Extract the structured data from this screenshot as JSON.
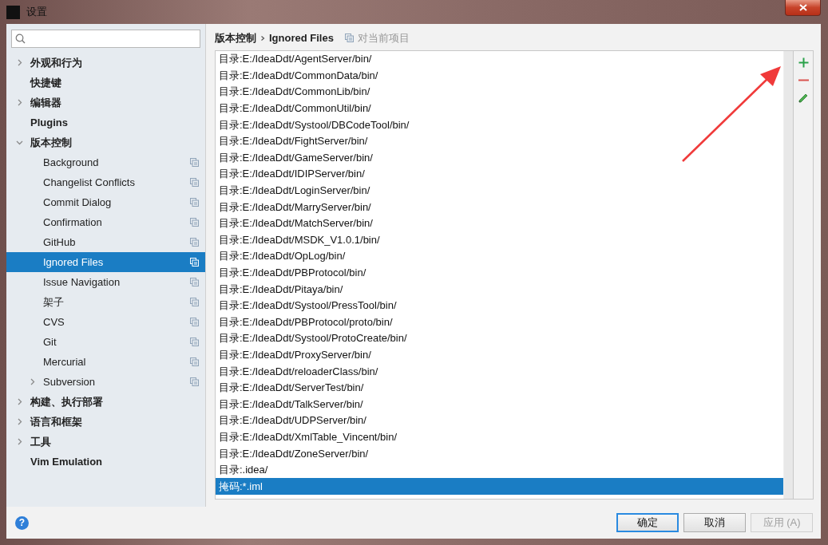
{
  "window": {
    "title": "设置"
  },
  "sidebar": {
    "items": [
      {
        "label": "外观和行为",
        "expanded": false,
        "selected": false
      },
      {
        "label": "快捷键",
        "selected": false
      },
      {
        "label": "编辑器",
        "expanded": false,
        "selected": false
      },
      {
        "label": "Plugins",
        "selected": false
      },
      {
        "label": "版本控制",
        "expanded": true,
        "selected": false,
        "children": [
          {
            "label": "Background",
            "selected": false,
            "project_scope": true
          },
          {
            "label": "Changelist Conflicts",
            "selected": false,
            "project_scope": true
          },
          {
            "label": "Commit Dialog",
            "selected": false,
            "project_scope": true
          },
          {
            "label": "Confirmation",
            "selected": false,
            "project_scope": true
          },
          {
            "label": "GitHub",
            "selected": false,
            "project_scope": true
          },
          {
            "label": "Ignored Files",
            "selected": true,
            "project_scope": true
          },
          {
            "label": "Issue Navigation",
            "selected": false,
            "project_scope": true
          },
          {
            "label": "架子",
            "selected": false,
            "project_scope": true
          },
          {
            "label": "CVS",
            "selected": false,
            "project_scope": true
          },
          {
            "label": "Git",
            "selected": false,
            "project_scope": true
          },
          {
            "label": "Mercurial",
            "selected": false,
            "project_scope": true
          },
          {
            "label": "Subversion",
            "expanded": false,
            "selected": false,
            "project_scope": true
          }
        ]
      },
      {
        "label": "构建、执行部署",
        "expanded": false,
        "selected": false
      },
      {
        "label": "语言和框架",
        "expanded": false,
        "selected": false
      },
      {
        "label": "工具",
        "expanded": false,
        "selected": false
      },
      {
        "label": "Vim Emulation",
        "selected": false
      }
    ]
  },
  "breadcrumb": {
    "path": [
      "版本控制",
      "Ignored Files"
    ],
    "scope": "对当前项目"
  },
  "ignored_list": {
    "rows": [
      {
        "text": "目录:E:/IdeaDdt/AgentServer/bin/",
        "selected": false
      },
      {
        "text": "目录:E:/IdeaDdt/CommonData/bin/",
        "selected": false
      },
      {
        "text": "目录:E:/IdeaDdt/CommonLib/bin/",
        "selected": false
      },
      {
        "text": "目录:E:/IdeaDdt/CommonUtil/bin/",
        "selected": false
      },
      {
        "text": "目录:E:/IdeaDdt/Systool/DBCodeTool/bin/",
        "selected": false
      },
      {
        "text": "目录:E:/IdeaDdt/FightServer/bin/",
        "selected": false
      },
      {
        "text": "目录:E:/IdeaDdt/GameServer/bin/",
        "selected": false
      },
      {
        "text": "目录:E:/IdeaDdt/IDIPServer/bin/",
        "selected": false
      },
      {
        "text": "目录:E:/IdeaDdt/LoginServer/bin/",
        "selected": false
      },
      {
        "text": "目录:E:/IdeaDdt/MarryServer/bin/",
        "selected": false
      },
      {
        "text": "目录:E:/IdeaDdt/MatchServer/bin/",
        "selected": false
      },
      {
        "text": "目录:E:/IdeaDdt/MSDK_V1.0.1/bin/",
        "selected": false
      },
      {
        "text": "目录:E:/IdeaDdt/OpLog/bin/",
        "selected": false
      },
      {
        "text": "目录:E:/IdeaDdt/PBProtocol/bin/",
        "selected": false
      },
      {
        "text": "目录:E:/IdeaDdt/Pitaya/bin/",
        "selected": false
      },
      {
        "text": "目录:E:/IdeaDdt/Systool/PressTool/bin/",
        "selected": false
      },
      {
        "text": "目录:E:/IdeaDdt/PBProtocol/proto/bin/",
        "selected": false
      },
      {
        "text": "目录:E:/IdeaDdt/Systool/ProtoCreate/bin/",
        "selected": false
      },
      {
        "text": "目录:E:/IdeaDdt/ProxyServer/bin/",
        "selected": false
      },
      {
        "text": "目录:E:/IdeaDdt/reloaderClass/bin/",
        "selected": false
      },
      {
        "text": "目录:E:/IdeaDdt/ServerTest/bin/",
        "selected": false
      },
      {
        "text": "目录:E:/IdeaDdt/TalkServer/bin/",
        "selected": false
      },
      {
        "text": "目录:E:/IdeaDdt/UDPServer/bin/",
        "selected": false
      },
      {
        "text": "目录:E:/IdeaDdt/XmlTable_Vincent/bin/",
        "selected": false
      },
      {
        "text": "目录:E:/IdeaDdt/ZoneServer/bin/",
        "selected": false
      },
      {
        "text": "目录:.idea/",
        "selected": false
      },
      {
        "text": "掩码:*.iml",
        "selected": true
      }
    ]
  },
  "help": "?",
  "buttons": [
    {
      "label": "确定",
      "kind": "default",
      "disabled": false
    },
    {
      "label": "取消",
      "kind": "normal",
      "disabled": false
    },
    {
      "label": "应用 (A)",
      "kind": "normal",
      "disabled": true
    }
  ]
}
